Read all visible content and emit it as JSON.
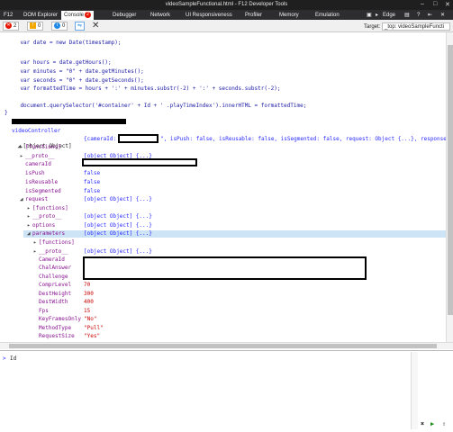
{
  "window": {
    "title": "videoSampleFunctional.html - F12 Developer Tools",
    "minimize": "–",
    "maximize": "□",
    "close": "✕"
  },
  "tabs": [
    {
      "label": "F12"
    },
    {
      "label": "DOM Explorer"
    },
    {
      "label": "Console",
      "badge": "2"
    },
    {
      "label": "Debugger"
    },
    {
      "label": "Network"
    },
    {
      "label": "UI Responsiveness"
    },
    {
      "label": "Profiler"
    },
    {
      "label": "Memory"
    },
    {
      "label": "Emulation"
    }
  ],
  "tab_right": {
    "monitor": "▣",
    "arrow": "▸",
    "mode": "Edge",
    "console": "▤",
    "help": "?",
    "pin": "⇤",
    "close": "✕"
  },
  "toolbar": {
    "errors": "2",
    "warnings": "0",
    "info": "0",
    "target_label": "Target:",
    "target_value": "_top: videoSampleFuncti"
  },
  "code": {
    "l1": "    var date = new Date(timestamp);",
    "l2": "    var hours = date.getHours();",
    "l3": "    var minutes = \"0\" + date.getMinutes();",
    "l4": "    var seconds = \"0\" + date.getSeconds();",
    "l5": "    var formattedTime = hours + ':' + minutes.substr(-2) + ':' + seconds.substr(-2);",
    "l6": "    document.querySelector('#container' + Id + ' .playTimeIndex').innerHTML = formattedTime;",
    "l7": "}"
  },
  "tree": {
    "heading": "videoController",
    "root_label": "[object Object]",
    "root_summary_a": "{cameraId: ",
    "root_summary_b": "\", isPush: false, isReusable: false, isSegmented: false, request: Object {...}, response: Object",
    "functions": "[functions]",
    "proto": "__proto__",
    "proto_value": "[object Object] {...}",
    "cameraId": "cameraId",
    "isPush": "isPush",
    "isPush_value": "false",
    "isReusable": "isReusable",
    "isReusable_value": "false",
    "isSegmented": "isSegmented",
    "isSegmented_value": "false",
    "request": "request",
    "request_value": "[object Object] {...}",
    "req_functions": "[functions]",
    "req_proto": "__proto__",
    "req_proto_value": "[object Object] {...}",
    "options": "options",
    "options_value": "[object Object] {...}",
    "parameters": "parameters",
    "parameters_value": "[object Object] {...}",
    "par_functions": "[functions]",
    "par_proto": "__proto__",
    "par_proto_value": "[object Object] {...}",
    "p_cameraId": "CameraId",
    "p_chalAnswer": "ChalAnswer",
    "p_challenge": "Challenge",
    "p_comprLevel": "ComprLevel",
    "p_comprLevel_value": "70",
    "p_destHeight": "DestHeight",
    "p_destHeight_value": "300",
    "p_destWidth": "DestWidth",
    "p_destWidth_value": "400",
    "p_fps": "Fps",
    "p_fps_value": "15",
    "p_keyFramesOnly": "KeyFramesOnly",
    "p_keyFramesOnly_value": "\"No\"",
    "p_methodType": "MethodType",
    "p_methodType_value": "\"Pull\"",
    "p_requestSize": "RequestSize",
    "p_requestSize_value": "\"Yes\""
  },
  "console_input": {
    "prompt": ">",
    "text": "Id",
    "run": "▶",
    "clear": "✖",
    "multiline": "⇧"
  }
}
